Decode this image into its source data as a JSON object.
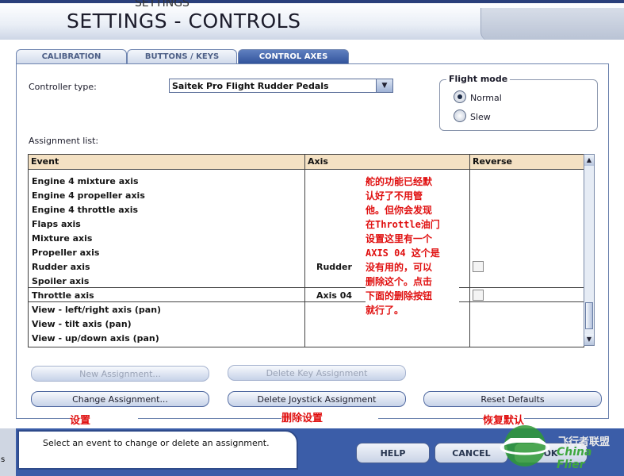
{
  "window": {
    "title": "SETTINGS - CONTROLS",
    "ghost_title": "SETTINGS"
  },
  "tabs": [
    {
      "label": "CALIBRATION",
      "active": false
    },
    {
      "label": "BUTTONS / KEYS",
      "active": false
    },
    {
      "label": "CONTROL AXES",
      "active": true
    }
  ],
  "controller": {
    "label": "Controller type:",
    "value": "Saitek Pro Flight Rudder Pedals"
  },
  "flight_mode": {
    "title": "Flight mode",
    "options": [
      {
        "label": "Normal",
        "selected": true
      },
      {
        "label": "Slew",
        "selected": false
      }
    ]
  },
  "assignment_list": {
    "label": "Assignment list:",
    "columns": [
      "Event",
      "Axis",
      "Reverse"
    ],
    "rows": [
      {
        "event": "Engine 4 mixture axis",
        "axis": "",
        "reverse": null
      },
      {
        "event": "Engine 4 propeller axis",
        "axis": "",
        "reverse": null
      },
      {
        "event": "Engine 4 throttle axis",
        "axis": "",
        "reverse": null
      },
      {
        "event": "Flaps axis",
        "axis": "",
        "reverse": null
      },
      {
        "event": "Mixture axis",
        "axis": "",
        "reverse": null
      },
      {
        "event": "Propeller axis",
        "axis": "",
        "reverse": null
      },
      {
        "event": "Rudder axis",
        "axis": "Rudder",
        "reverse": false
      },
      {
        "event": "Spoiler axis",
        "axis": "",
        "reverse": null
      },
      {
        "event": "Throttle axis",
        "axis": "Axis 04",
        "reverse": false,
        "selected": true
      },
      {
        "event": "View - left/right axis (pan)",
        "axis": "",
        "reverse": null
      },
      {
        "event": "View - tilt axis (pan)",
        "axis": "",
        "reverse": null
      },
      {
        "event": "View - up/down axis (pan)",
        "axis": "",
        "reverse": null
      }
    ]
  },
  "overlay_note": {
    "lines": [
      "舵的功能已经默",
      "认好了不用管",
      "他。但你会发现",
      "在Throttle油门",
      "设置这里有一个",
      "AXIS 04 这个是",
      "没有用的，可以",
      "删除这个。点击",
      "下面的删除按钮",
      "就行了。"
    ]
  },
  "buttons": {
    "new_assignment": "New Assignment...",
    "delete_key_assignment": "Delete Key Assignment",
    "change_assignment": "Change Assignment...",
    "delete_joystick_assignment": "Delete Joystick Assignment",
    "reset_defaults": "Reset Defaults"
  },
  "annotations": {
    "change": "设置",
    "delete": "删除设置",
    "reset": "恢复默认"
  },
  "status_text": "Select an event to change or delete an assignment.",
  "bottom_left_text": "s",
  "footer_buttons": {
    "help": "HELP",
    "cancel": "CANCEL",
    "ok": "OK"
  },
  "logo": {
    "line1": "飞行者联盟",
    "line2": "China Flier"
  },
  "colors": {
    "note_red": "#e01010",
    "header_bg": "#f4e1c3",
    "tab_active": "#2d4f98"
  }
}
